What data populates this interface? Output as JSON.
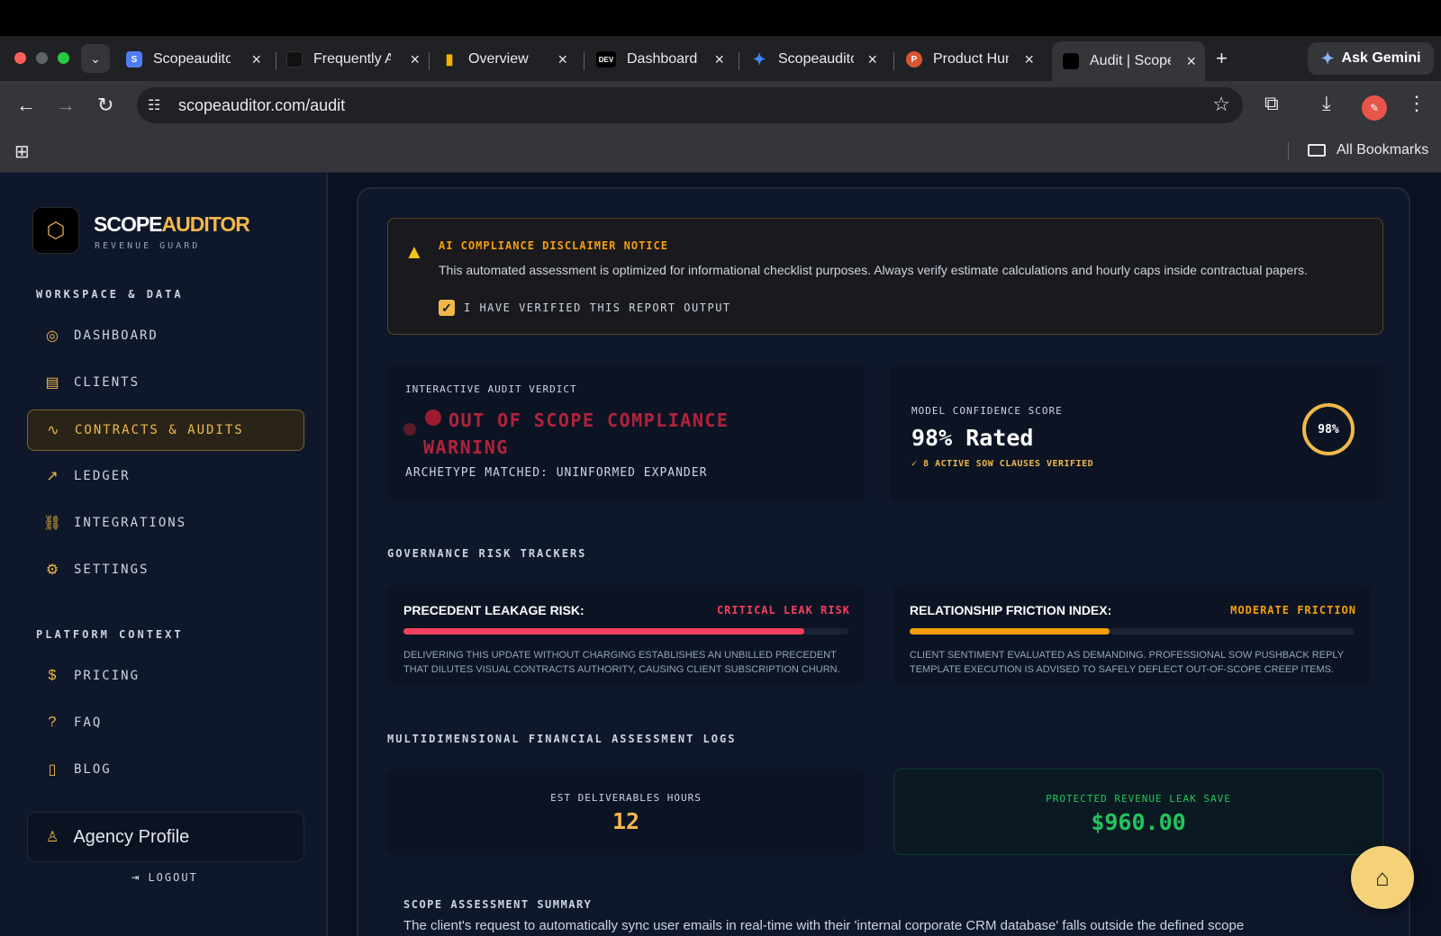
{
  "browser": {
    "tabs": [
      {
        "label": "Scopeauditor",
        "favicon": "S",
        "color": "#4f7cf7"
      },
      {
        "label": "Frequently Asked",
        "favicon": "",
        "color": "#000000"
      },
      {
        "label": "Overview",
        "favicon": "▮",
        "color": "#f4b400"
      },
      {
        "label": "Dashboard",
        "favicon": "DEV",
        "color": "#000000"
      },
      {
        "label": "Scopeauditor",
        "favicon": "✦",
        "color": "#4285f4"
      },
      {
        "label": "Product Hunt",
        "favicon": "P",
        "color": "#da552f"
      },
      {
        "label": "Audit | Scope",
        "favicon": "",
        "color": "#000000"
      }
    ],
    "gemini_label": "Ask Gemini",
    "url": "scopeauditor.com/audit",
    "bookmarks_label": "All Bookmarks"
  },
  "brand": {
    "name_main": "SCOPE",
    "name_accent": "AUDITOR",
    "tagline": "REVENUE GUARD"
  },
  "sidebar": {
    "section_workspace": "WORKSPACE & DATA",
    "workspace_items": [
      {
        "label": "DASHBOARD",
        "icon": "target-icon"
      },
      {
        "label": "CLIENTS",
        "icon": "file-icon"
      },
      {
        "label": "CONTRACTS & AUDITS",
        "icon": "activity-icon"
      },
      {
        "label": "LEDGER",
        "icon": "trend-up-icon"
      },
      {
        "label": "INTEGRATIONS",
        "icon": "network-icon"
      },
      {
        "label": "SETTINGS",
        "icon": "gear-icon"
      }
    ],
    "section_platform": "PLATFORM CONTEXT",
    "platform_items": [
      {
        "label": "PRICING",
        "icon": "dollar-icon"
      },
      {
        "label": "FAQ",
        "icon": "help-icon"
      },
      {
        "label": "BLOG",
        "icon": "book-icon"
      }
    ],
    "profile_label": "Agency Profile",
    "logout_label": "LOGOUT"
  },
  "notice": {
    "title": "AI COMPLIANCE DISCLAIMER NOTICE",
    "text": "This automated assessment is optimized for informational checklist purposes. Always verify estimate calculations and hourly caps inside contractual papers.",
    "checkbox_label": "I HAVE VERIFIED THIS REPORT OUTPUT",
    "checked": true
  },
  "verdict": {
    "caption": "INTERACTIVE AUDIT VERDICT",
    "title": "OUT OF SCOPE COMPLIANCE WARNING",
    "archetype": "ARCHETYPE MATCHED: UNINFORMED EXPANDER"
  },
  "confidence": {
    "caption": "MODEL CONFIDENCE SCORE",
    "value": "98% Rated",
    "subtext": "✓ 8 ACTIVE SOW CLAUSES VERIFIED",
    "gauge_label": "98%",
    "gauge_fraction": 0.98
  },
  "risk_heading": "GOVERNANCE RISK TRACKERS",
  "risks": [
    {
      "title": "PRECEDENT LEAKAGE RISK:",
      "badge": "CRITICAL LEAK RISK",
      "badge_color": "#f43f5e",
      "bar_color": "#f43f5e",
      "level": 0.9,
      "text": "DELIVERING THIS UPDATE WITHOUT CHARGING ESTABLISHES AN UNBILLED PRECEDENT THAT DILUTES VISUAL CONTRACTS AUTHORITY, CAUSING CLIENT SUBSCRIPTION CHURN."
    },
    {
      "title": "RELATIONSHIP FRICTION INDEX:",
      "badge": "MODERATE FRICTION",
      "badge_color": "#f59e0b",
      "bar_color": "#f59e0b",
      "level": 0.45,
      "text": "CLIENT SENTIMENT EVALUATED AS DEMANDING. PROFESSIONAL SOW PUSHBACK REPLY TEMPLATE EXECUTION IS ADVISED TO SAFELY DEFLECT OUT-OF-SCOPE CREEP ITEMS."
    }
  ],
  "financial_heading": "MULTIDIMENSIONAL FINANCIAL ASSESSMENT LOGS",
  "financial": {
    "hours_caption": "EST DELIVERABLES HOURS",
    "hours_value": "12",
    "save_caption": "PROTECTED REVENUE LEAK SAVE",
    "save_value": "$960.00"
  },
  "summary": {
    "caption": "SCOPE ASSESSMENT SUMMARY",
    "text": "The client's request to automatically sync user emails in real-time with their 'internal corporate CRM database' falls outside the defined scope"
  },
  "colors": {
    "accent": "#f0b84a",
    "danger": "#b3223c",
    "success": "#22c55e"
  }
}
